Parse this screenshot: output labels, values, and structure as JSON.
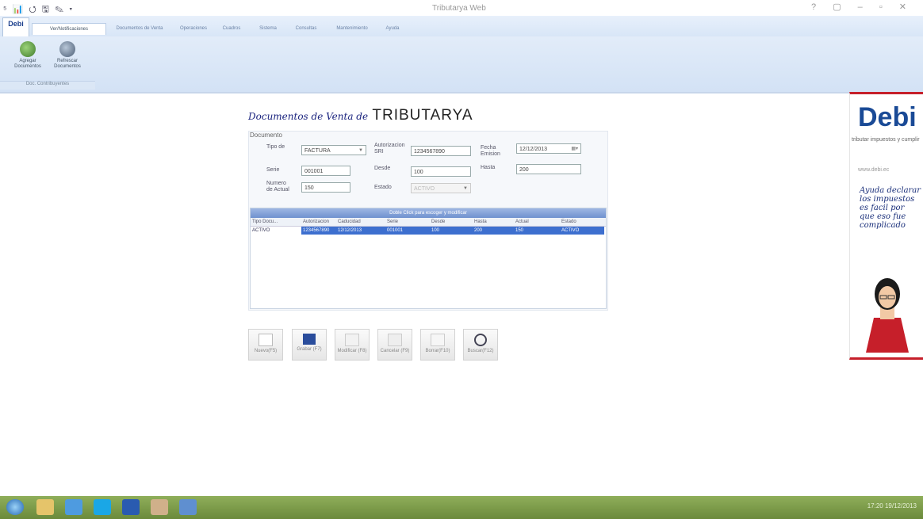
{
  "window": {
    "title": "Tributarya Web",
    "quick_access": "⁵ 📊 ⭯ 🖫 ✎ ▾ ",
    "controls": "? ▢ – ▫ ✕",
    "logo_text": "Debi"
  },
  "ribbon": {
    "tabs": [
      "Ver/Notificaciones",
      "Documentos de Venta",
      "Operaciones",
      "Cuadros",
      "Sistema",
      "Consultas",
      "Mantenimiento",
      "Ayuda"
    ],
    "buttons": [
      {
        "label": "Agregar Documentos",
        "icon": "add-document-icon"
      },
      {
        "label": "Refrescar Documentos",
        "icon": "refresh-icon"
      }
    ],
    "group_label": "Doc. Contribuyentes"
  },
  "form": {
    "title_script": "Documentos de Venta de",
    "title_brand": "TRIBUTARYA",
    "section_label": "Documento",
    "fields": {
      "tipo_label": "Tipo de",
      "tipo_value": "FACTURA",
      "autorizacion_label": "Autorizacion SRI",
      "autorizacion_value": "1234567890",
      "fecha_label": "Fecha Emision",
      "fecha_value": "12/12/2013",
      "serie_label": "Serie",
      "serie_value": "001001",
      "inicio_label": "Desde",
      "inicio_value": "100",
      "fin_label": "Hasta",
      "fin_value": "200",
      "numero_label": "Numero de Actual",
      "numero_value": "150",
      "estado_label": "Estado",
      "estado_value": "ACTIVO"
    }
  },
  "grid": {
    "header": "Doble Click para escoger y modificar",
    "columns": [
      "Tipo Docu...",
      "Autorizacion",
      "Caducidad",
      "Serie",
      "Desde",
      "Hasta",
      "Actual",
      "Estado"
    ],
    "rows": [
      {
        "cells": [
          "ACTIVO",
          "1234567890",
          "12/12/2013",
          "001001",
          "100",
          "200",
          "150",
          "ACTIVO"
        ]
      }
    ]
  },
  "toolbar": {
    "buttons": [
      {
        "label": "Nuevo(F5)",
        "icon": "new-document-icon"
      },
      {
        "label": "Grabar (F7)",
        "icon": "save-icon"
      },
      {
        "label": "Modificar (F8)",
        "icon": "edit-icon"
      },
      {
        "label": "Cancelar (F9)",
        "icon": "cancel-icon"
      },
      {
        "label": "Borrar(F10)",
        "icon": "delete-icon"
      },
      {
        "label": "Buscar(F12)",
        "icon": "search-icon"
      }
    ]
  },
  "ad": {
    "brand": "Debi",
    "subtitle": "tributar impuestos y cumplir",
    "url": "www.debi.ec",
    "handwritten": "Ayuda declarar los impuestos es facil por que eso fue complicado",
    "brand_color": "#1a4a96",
    "accent_color": "#c61f2a"
  },
  "taskbar": {
    "apps": [
      "start-orb-icon",
      "explorer-icon",
      "ie-icon",
      "skype-icon",
      "word-icon",
      "photo-icon",
      "app-icon"
    ],
    "clock": "17:20\n19/12/2013"
  }
}
